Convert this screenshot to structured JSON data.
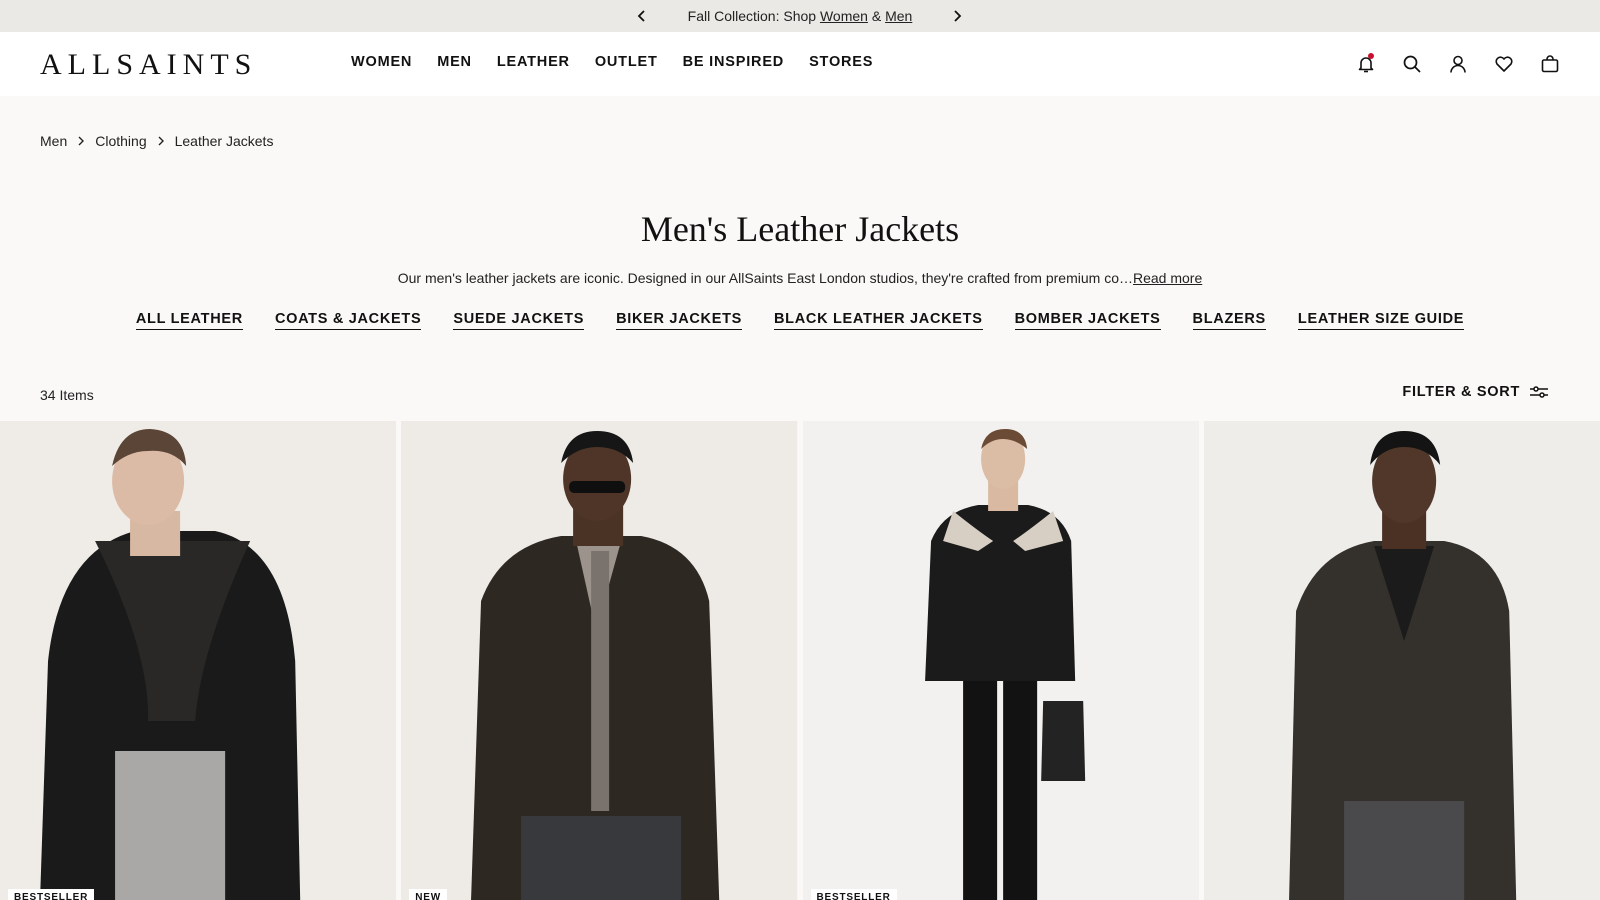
{
  "promo": {
    "prefix": "Fall Collection: Shop ",
    "women_link": "Women",
    "amp": " & ",
    "men_link": "Men"
  },
  "header": {
    "logo": "ALLSAINTS",
    "nav": [
      "WOMEN",
      "MEN",
      "LEATHER",
      "OUTLET",
      "BE INSPIRED",
      "STORES"
    ],
    "icons": [
      "bell-icon",
      "search-icon",
      "account-icon",
      "wishlist-icon",
      "bag-icon"
    ]
  },
  "breadcrumb": [
    "Men",
    "Clothing",
    "Leather Jackets"
  ],
  "page": {
    "title": "Men's Leather Jackets",
    "intro": "Our men's leather jackets are iconic. Designed in our AllSaints East London studios, they're crafted from premium co…",
    "read_more": "Read more"
  },
  "categories": [
    "ALL LEATHER",
    "COATS & JACKETS",
    "SUEDE JACKETS",
    "BIKER JACKETS",
    "BLACK LEATHER JACKETS",
    "BOMBER JACKETS",
    "BLAZERS",
    "LEATHER SIZE GUIDE"
  ],
  "listing": {
    "count": "34 Items",
    "filter_label": "FILTER & SORT"
  },
  "products": [
    {
      "badge": "BESTSELLER"
    },
    {
      "badge": "NEW"
    },
    {
      "badge": "BESTSELLER"
    },
    {
      "badge": ""
    }
  ],
  "colors": {
    "promo_bg": "#ebe9e5",
    "page_bg": "#faf9f7",
    "text": "#111111",
    "notification_dot": "#c8102e"
  }
}
